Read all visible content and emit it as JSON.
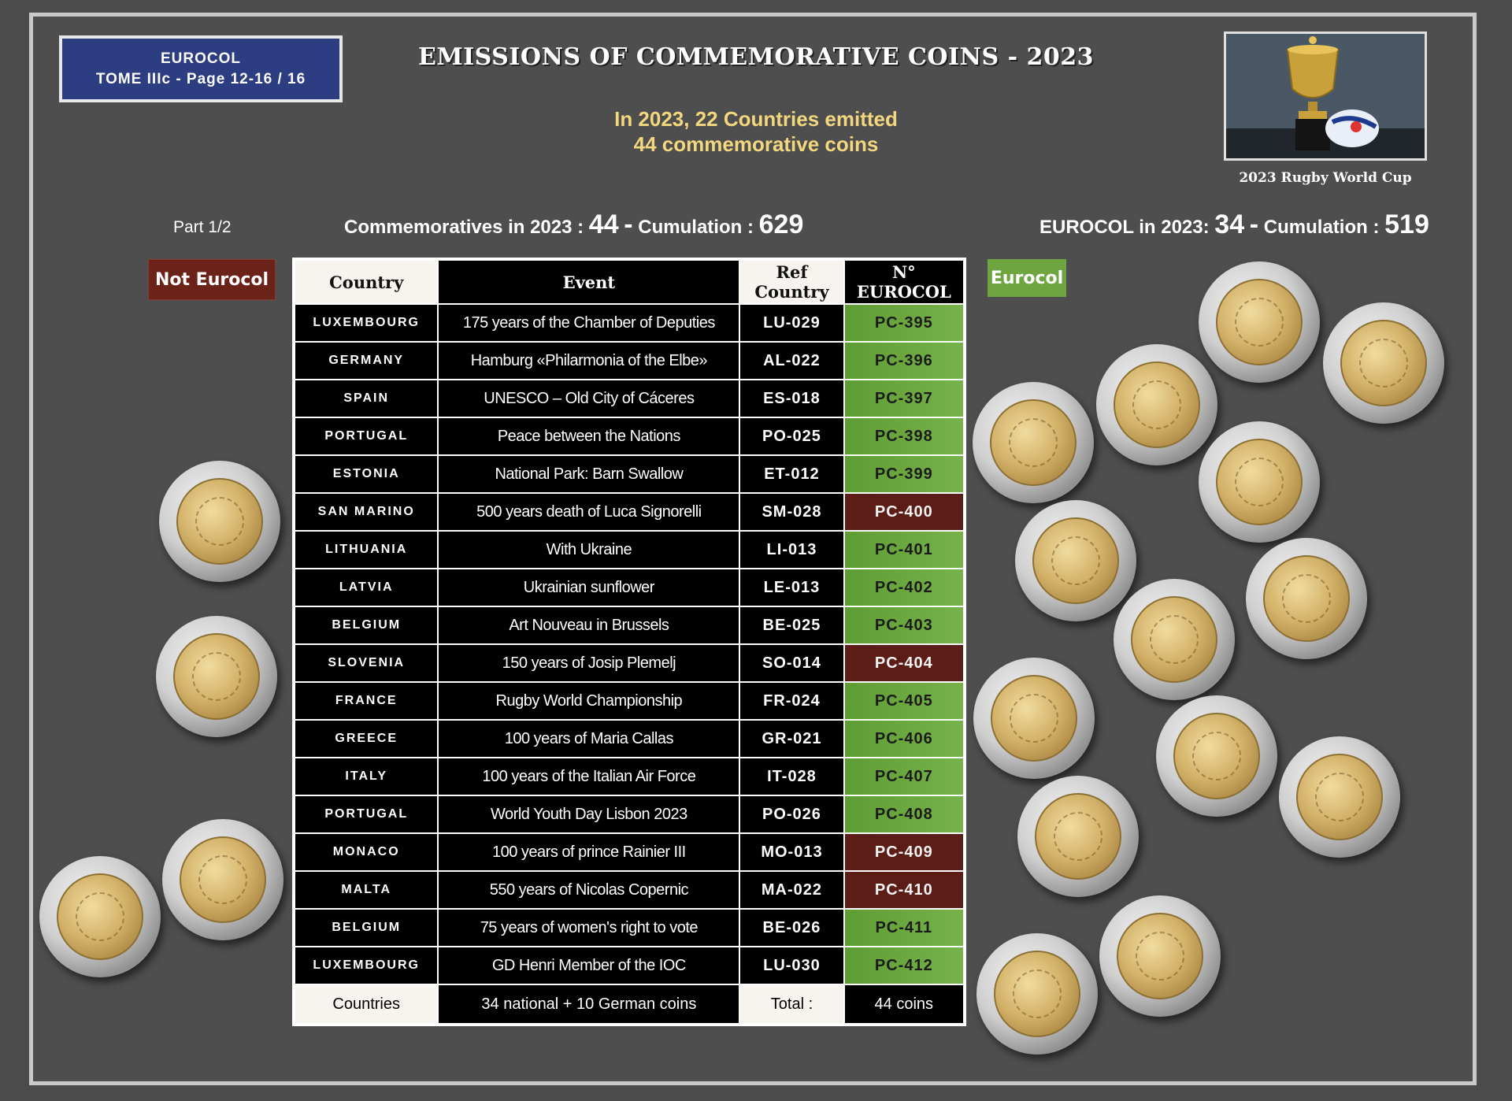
{
  "header": {
    "tome_line1": "EUROCOL",
    "tome_line2": "TOME IIIc - Page 12-16 / 16",
    "title": "EMISSIONS OF COMMEMORATIVE COINS - 2023",
    "subtitle_line1": "In 2023, 22 Countries emitted",
    "subtitle_line2": "44 commemorative coins",
    "trophy_caption": "2023 Rugby World Cup"
  },
  "stats": {
    "part": "Part 1/2",
    "comm_label": "Commemoratives in 2023 :",
    "comm_value": "44",
    "cum_label": "Cumulation :",
    "cum_value": "629",
    "eurocol_label": "EUROCOL in 2023:",
    "eurocol_value": "34",
    "eurocol_cum_label": "Cumulation :",
    "eurocol_cum_value": "519"
  },
  "badges": {
    "not_eurocol": "Not Eurocol",
    "eurocol": "Eurocol"
  },
  "table": {
    "headers": [
      "Country",
      "Event",
      "Ref Country",
      "N° EUROCOL"
    ],
    "rows": [
      {
        "country": "LUXEMBOURG",
        "event": "175 years of the Chamber of Deputies",
        "ref": "LU-029",
        "pc": "PC-395",
        "status": "green"
      },
      {
        "country": "GERMANY",
        "event": "Hamburg «Philarmonia of the Elbe»",
        "ref": "AL-022",
        "pc": "PC-396",
        "status": "green"
      },
      {
        "country": "SPAIN",
        "event": "UNESCO – Old City of Cáceres",
        "ref": "ES-018",
        "pc": "PC-397",
        "status": "green"
      },
      {
        "country": "PORTUGAL",
        "event": "Peace between the Nations",
        "ref": "PO-025",
        "pc": "PC-398",
        "status": "green"
      },
      {
        "country": "ESTONIA",
        "event": "National Park: Barn Swallow",
        "ref": "ET-012",
        "pc": "PC-399",
        "status": "green"
      },
      {
        "country": "SAN MARINO",
        "event": "500 years death of Luca Signorelli",
        "ref": "SM-028",
        "pc": "PC-400",
        "status": "red"
      },
      {
        "country": "LITHUANIA",
        "event": "With Ukraine",
        "ref": "LI-013",
        "pc": "PC-401",
        "status": "green"
      },
      {
        "country": "LATVIA",
        "event": "Ukrainian sunflower",
        "ref": "LE-013",
        "pc": "PC-402",
        "status": "green"
      },
      {
        "country": "BELGIUM",
        "event": "Art Nouveau in Brussels",
        "ref": "BE-025",
        "pc": "PC-403",
        "status": "green"
      },
      {
        "country": "SLOVENIA",
        "event": "150 years of Josip Plemelj",
        "ref": "SO-014",
        "pc": "PC-404",
        "status": "red"
      },
      {
        "country": "FRANCE",
        "event": "Rugby World Championship",
        "ref": "FR-024",
        "pc": "PC-405",
        "status": "green"
      },
      {
        "country": "GREECE",
        "event": "100 years of Maria Callas",
        "ref": "GR-021",
        "pc": "PC-406",
        "status": "green"
      },
      {
        "country": "ITALY",
        "event": "100 years of the Italian Air Force",
        "ref": "IT-028",
        "pc": "PC-407",
        "status": "green"
      },
      {
        "country": "PORTUGAL",
        "event": "World Youth Day Lisbon 2023",
        "ref": "PO-026",
        "pc": "PC-408",
        "status": "green"
      },
      {
        "country": "MONACO",
        "event": "100 years of prince Rainier III",
        "ref": "MO-013",
        "pc": "PC-409",
        "status": "red"
      },
      {
        "country": "MALTA",
        "event": "550 years of Nicolas Copernic",
        "ref": "MA-022",
        "pc": "PC-410",
        "status": "red"
      },
      {
        "country": "BELGIUM",
        "event": "75 years of women's right to vote",
        "ref": "BE-026",
        "pc": "PC-411",
        "status": "green"
      },
      {
        "country": "LUXEMBOURG",
        "event": "GD Henri Member of the IOC",
        "ref": "LU-030",
        "pc": "PC-412",
        "status": "green"
      }
    ],
    "footer": [
      "Countries",
      "34 national +  10  German coins",
      "Total :",
      "44 coins"
    ]
  },
  "colors": {
    "background": "#4b4b4b",
    "eurocol_green": "#6ea540",
    "not_eurocol_red": "#5c1d16",
    "title_box_blue": "#2c3d82",
    "subtitle_yellow": "#f3d77e"
  }
}
